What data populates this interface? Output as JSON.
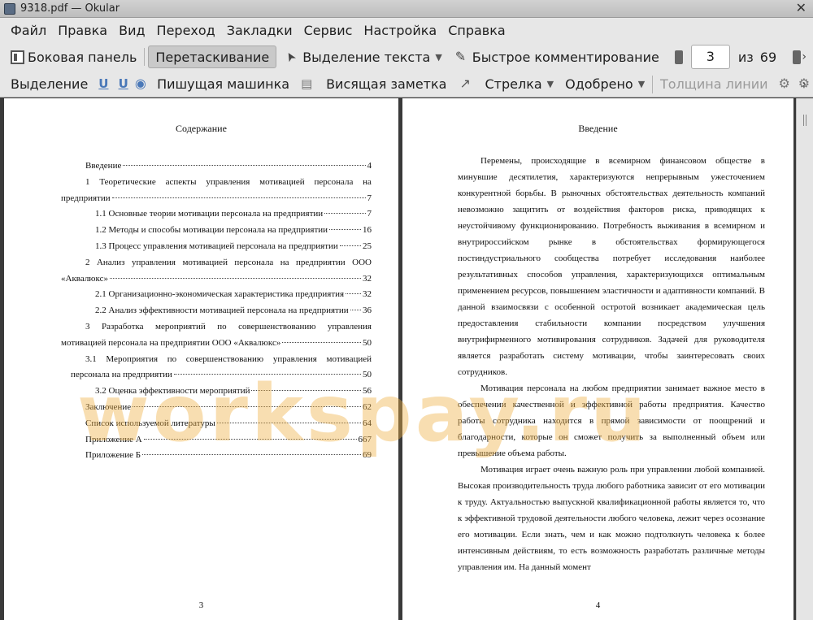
{
  "window": {
    "title": "9318.pdf — Okular"
  },
  "menu": [
    "Файл",
    "Правка",
    "Вид",
    "Переход",
    "Закладки",
    "Сервис",
    "Настройка",
    "Справка"
  ],
  "toolbar1": {
    "sidebar": "Боковая панель",
    "browse": "Перетаскивание",
    "text_select": "Выделение текста",
    "quick_annotate": "Быстрое комментирование",
    "current_page": "3",
    "of_label": "из",
    "total_pages": "69"
  },
  "toolbar2": {
    "highlight": "Выделение",
    "typewriter": "Пишущая машинка",
    "sticky_note": "Висящая заметка",
    "arrow": "Стрелка",
    "stamp": "Одобрено",
    "line_width": "Толщина линии"
  },
  "page_left": {
    "heading": "Содержание",
    "number": "3",
    "toc": [
      {
        "type": "row",
        "cls": "l0",
        "text": "Введение",
        "page": "4"
      },
      {
        "type": "just",
        "cls": "j",
        "words": [
          "1",
          "Теоретические",
          "аспекты",
          "управления",
          "мотивацией",
          "персонала",
          "на"
        ]
      },
      {
        "type": "row",
        "cls": "cont",
        "text": "предприятии",
        "page": "7"
      },
      {
        "type": "row",
        "cls": "l1",
        "text": "1.1 Основные теории мотивации персонала на предприятии",
        "page": "7"
      },
      {
        "type": "row",
        "cls": "l1",
        "text": "1.2 Методы и способы мотивации персонала на предприятии",
        "page": "16"
      },
      {
        "type": "row",
        "cls": "l1",
        "text": "1.3 Процесс управления мотивацией персонала на предприятии",
        "page": "25"
      },
      {
        "type": "just",
        "cls": "j",
        "words": [
          "2",
          "Анализ",
          "управления",
          "мотивацией",
          "персонала",
          "на",
          "предприятии",
          "ООО"
        ]
      },
      {
        "type": "row",
        "cls": "cont",
        "text": "«Аквалюкс»",
        "page": "32"
      },
      {
        "type": "row",
        "cls": "l1",
        "text": "2.1 Организационно-экономическая характеристика предприятия",
        "page": "32"
      },
      {
        "type": "row",
        "cls": "l1",
        "text": "2.2 Анализ эффективности мотивацией персонала на предприятии",
        "page": "36"
      },
      {
        "type": "just",
        "cls": "j",
        "words": [
          "3",
          "Разработка",
          "мероприятий",
          "по",
          "совершенствованию",
          "управления"
        ]
      },
      {
        "type": "row",
        "cls": "cont",
        "text": "мотивацией персонала на предприятии ООО «Аквалюкс»",
        "page": "50"
      },
      {
        "type": "just",
        "cls": "j l1",
        "words": [
          "3.1",
          "Мероприятия",
          "по",
          "совершенствованию",
          "управления",
          "мотивацией"
        ]
      },
      {
        "type": "row",
        "cls": "cont2",
        "text": "персонала на предприятии",
        "page": "50"
      },
      {
        "type": "row",
        "cls": "l1",
        "text": "3.2 Оценка эффективности мероприятий",
        "page": "56"
      },
      {
        "type": "row",
        "cls": "l0",
        "text": "Заключение",
        "page": "62"
      },
      {
        "type": "row",
        "cls": "l0",
        "text": "Список используемой литературы",
        "page": "64"
      },
      {
        "type": "row",
        "cls": "l0",
        "text": "Приложение А",
        "page": "667"
      },
      {
        "type": "row",
        "cls": "l0",
        "text": "Приложение Б",
        "page": "69"
      }
    ]
  },
  "page_right": {
    "heading": "Введение",
    "number": "4",
    "paragraphs": [
      "Перемены, происходящие в всемирном финансовом обществе в минувшие десятилетия, характеризуются непрерывным ужесточением конкурентной борьбы. В рыночных обстоятельствах деятельность компаний невозможно защитить от воздействия факторов риска, приводящих к неустойчивому функционированию. Потребность выживания в всемирном и внутрироссийском рынке в обстоятельствах формирующегося постиндустриального сообщества потребует исследования наиболее результативных способов управления, характеризующихся оптимальным применением ресурсов, повышением эластичности и адаптивности компаний. В данной взаимосвязи с особенной остротой возникает академическая цель предоставления стабильности компании посредством улучшения внутрифирменного мотивирования сотрудников. Задачей для руководителя является разработать систему мотивации, чтобы заинтересовать своих сотрудников.",
      "Мотивация персонала на любом предприятии занимает важное место в обеспечении качественной и эффективной работы предприятия. Качество работы сотрудника находится в прямой зависимости от поощрений и благодарности, которые он сможет получить за выполненный объем или превышение объема работы.",
      "Мотивация играет очень важную роль при управлении любой компанией. Высокая производительность труда любого работника зависит от его мотивации к труду. Актуальностью выпускной квалификационной работы является то, что к эффективной трудовой деятельности любого человека, лежит через осознание его мотивации. Если знать, чем и как можно подтолкнуть человека к более интенсивным действиям, то есть возможность разработать различные методы управления им. На данный момент"
    ]
  },
  "watermark": "workspay.ru",
  "colors": {
    "watermark": "#eeb044",
    "window_bg": "#3a3a3a",
    "toolbar_bg": "#e7e7e7"
  }
}
